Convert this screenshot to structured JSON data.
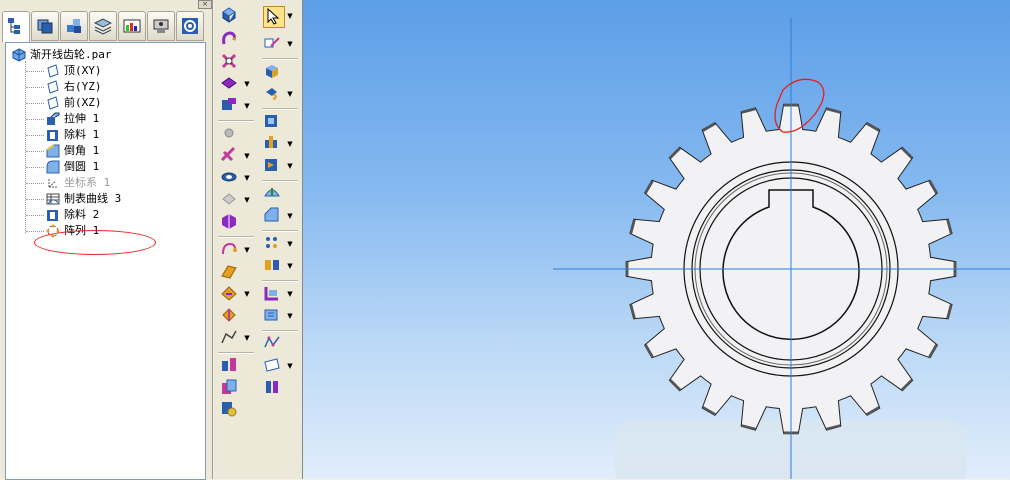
{
  "feature_tree": {
    "root": "渐开线齿轮.par",
    "items": [
      {
        "label": "顶(XY)",
        "icon": "plane-icon",
        "dim": false
      },
      {
        "label": "右(YZ)",
        "icon": "plane-icon",
        "dim": false
      },
      {
        "label": "前(XZ)",
        "icon": "plane-icon",
        "dim": false
      },
      {
        "label": "拉伸 1",
        "icon": "extrude-icon",
        "dim": false
      },
      {
        "label": "除料 1",
        "icon": "cutout-icon",
        "dim": false
      },
      {
        "label": "倒角 1",
        "icon": "chamfer-icon",
        "dim": false
      },
      {
        "label": "倒圆 1",
        "icon": "round-icon",
        "dim": false
      },
      {
        "label": "坐标系 1",
        "icon": "coordinate-system-icon",
        "dim": true
      },
      {
        "label": "制表曲线 3",
        "icon": "table-curve-icon",
        "dim": false
      },
      {
        "label": "除料 2",
        "icon": "cutout-icon",
        "dim": false
      },
      {
        "label": "阵列 1",
        "icon": "pattern-icon",
        "dim": false
      }
    ]
  },
  "panel_tabs": [
    "feature-pathfinder-icon",
    "parts-library-icon",
    "assembly-icon",
    "layers-icon",
    "sensors-icon",
    "view-manager-icon",
    "settings-icon"
  ],
  "colors": {
    "viewport_top": "#5c9ee8",
    "viewport_bottom": "#e0edfb",
    "gear_fill": "#f2f2f4",
    "annotation": "#e22222",
    "axis_line": "#2a7fd6",
    "select_highlight": "#ffe38a"
  },
  "gear": {
    "teeth": 24
  }
}
